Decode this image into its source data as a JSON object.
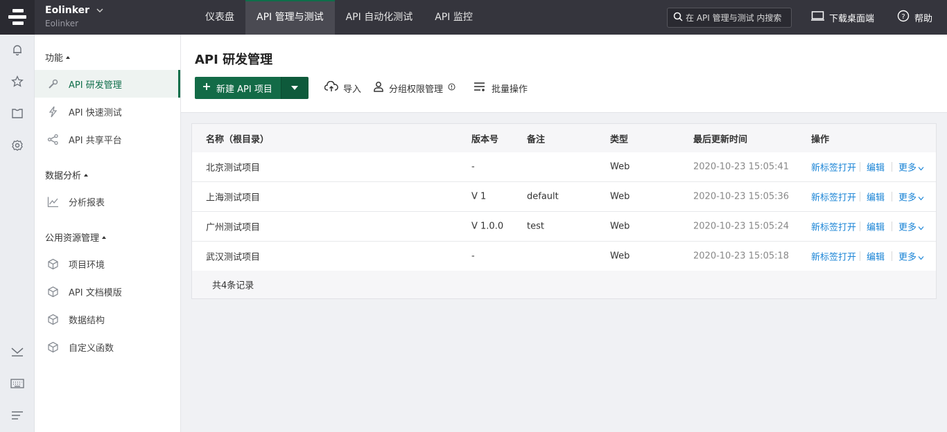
{
  "brand": {
    "name": "Eolinker",
    "sub": "Eolinker"
  },
  "nav": [
    {
      "label": "仪表盘"
    },
    {
      "label": "API 管理与测试"
    },
    {
      "label": "API 自动化测试"
    },
    {
      "label": "API 监控"
    }
  ],
  "search": {
    "placeholder": "在 API 管理与测试 内搜索"
  },
  "top_right": {
    "download": "下载桌面端",
    "help": "帮助"
  },
  "sidebar": {
    "groups": [
      {
        "title": "功能",
        "items": [
          {
            "label": "API 研发管理"
          },
          {
            "label": "API 快速测试"
          },
          {
            "label": "API 共享平台"
          }
        ]
      },
      {
        "title": "数据分析",
        "items": [
          {
            "label": "分析报表"
          }
        ]
      },
      {
        "title": "公用资源管理",
        "items": [
          {
            "label": "项目环境"
          },
          {
            "label": "API 文档模版"
          },
          {
            "label": "数据结构"
          },
          {
            "label": "自定义函数"
          }
        ]
      }
    ]
  },
  "main": {
    "title": "API 研发管理",
    "new_button": "新建 API 项目",
    "toolbar": {
      "import": "导入",
      "group_perm": "分组权限管理",
      "batch": "批量操作"
    }
  },
  "table": {
    "headers": {
      "name": "名称（根目录）",
      "version": "版本号",
      "remark": "备注",
      "type": "类型",
      "updated": "最后更新时间",
      "ops": "操作"
    },
    "rows": [
      {
        "name": "北京测试项目",
        "version": "-",
        "remark": "",
        "type": "Web",
        "updated": "2020-10-23 15:05:41"
      },
      {
        "name": "上海测试项目",
        "version": "V 1",
        "remark": "default",
        "type": "Web",
        "updated": "2020-10-23 15:05:36"
      },
      {
        "name": "广州测试项目",
        "version": "V 1.0.0",
        "remark": "test",
        "type": "Web",
        "updated": "2020-10-23 15:05:24"
      },
      {
        "name": "武汉测试项目",
        "version": "-",
        "remark": "",
        "type": "Web",
        "updated": "2020-10-23 15:05:18"
      }
    ],
    "ops": {
      "open": "新标签打开",
      "edit": "编辑",
      "more": "更多"
    },
    "footer": "共4条记录"
  },
  "colors": {
    "accent": "#136b47",
    "topbar": "#35353d",
    "link": "#1a84d6"
  }
}
